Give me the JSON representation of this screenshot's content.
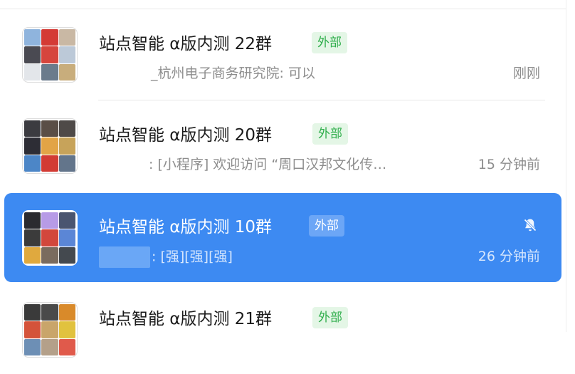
{
  "chats": [
    {
      "title": "站点智能 α版内测 22群",
      "tag": "外部",
      "preview_sender": "_杭州电子商务研究院",
      "preview_text": ": 可以",
      "time": "刚刚",
      "selected": false,
      "avatar_colors": [
        "#8fb4dd",
        "#d43a35",
        "#c9b8a4",
        "#4a4a52",
        "#d6453d",
        "#bcc9d8",
        "#e3e6ea",
        "#6b7b8c",
        "#c8ad7c"
      ]
    },
    {
      "title": "站点智能 α版内测 20群",
      "tag": "外部",
      "preview_sender": "",
      "preview_text": ": [小程序] 欢迎访问 “周口汉邦文化传…",
      "time": "15 分钟前",
      "selected": false,
      "avatar_colors": [
        "#3b3b40",
        "#5a4e46",
        "#4f4a48",
        "#2d2d35",
        "#e2a446",
        "#c7a35a",
        "#4c86c7",
        "#d23b34",
        "#63758b"
      ]
    },
    {
      "title": "站点智能 α版内测 10群",
      "tag": "外部",
      "preview_sender": "",
      "preview_text": ": [强][强][强]",
      "time": "26 分钟前",
      "selected": true,
      "muted": true,
      "avatar_colors": [
        "#2b2b30",
        "#b79be6",
        "#4a5570",
        "#3b3b3b",
        "#d2473c",
        "#5b86d6",
        "#e0a93e",
        "#7a6b5e",
        "#44494f"
      ]
    },
    {
      "title": "站点智能 α版内测 21群",
      "tag": "外部",
      "selected": false,
      "avatar_colors": [
        "#3a3a3a",
        "#4a4a4a",
        "#d98a2a",
        "#d4533a",
        "#c9a56a",
        "#e1c23e",
        "#6d8fb5",
        "#b4a08a",
        "#e05a4b"
      ]
    }
  ],
  "icons": {
    "mute": "bell-slash-icon"
  }
}
